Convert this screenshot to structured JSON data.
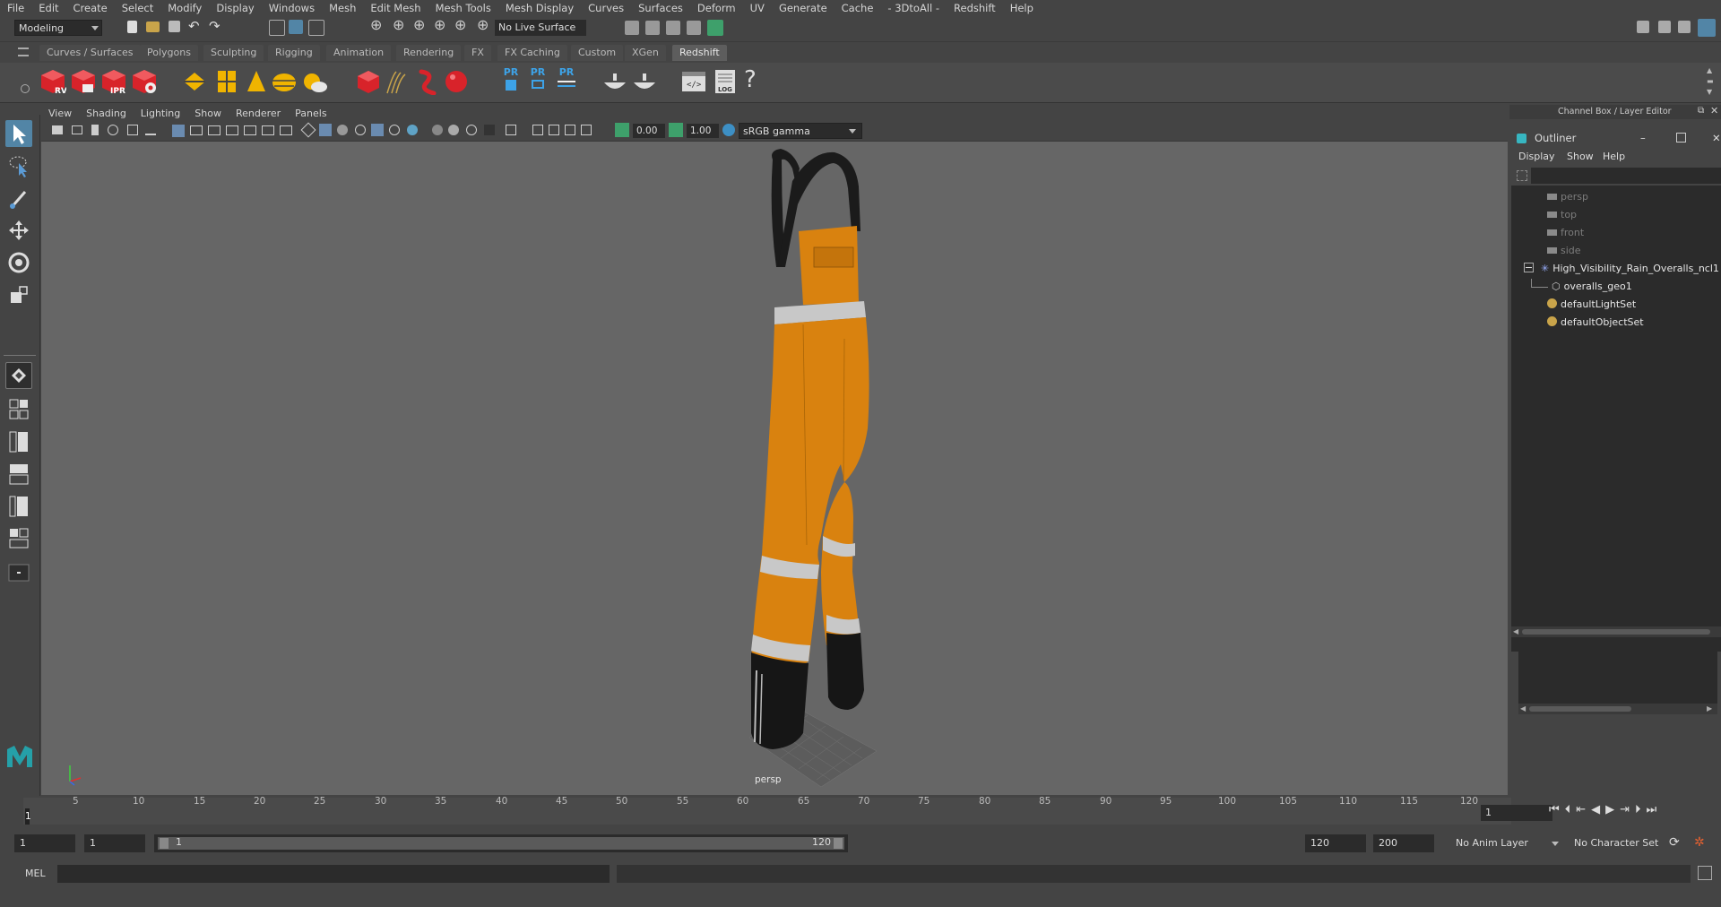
{
  "menubar": {
    "items": [
      "File",
      "Edit",
      "Create",
      "Select",
      "Modify",
      "Display",
      "Windows",
      "Mesh",
      "Edit Mesh",
      "Mesh Tools",
      "Mesh Display",
      "Curves",
      "Surfaces",
      "Deform",
      "UV",
      "Generate",
      "Cache",
      "- 3DtoAll -",
      "Redshift",
      "Help"
    ]
  },
  "statusline": {
    "mode": "Modeling",
    "live_surface": "No Live Surface"
  },
  "shelf": {
    "tabs": [
      "Curves / Surfaces",
      "Polygons",
      "Sculpting",
      "Rigging",
      "Animation",
      "Rendering",
      "FX",
      "FX Caching",
      "Custom",
      "XGen",
      "Redshift"
    ],
    "active_tab": "Redshift",
    "icon_labels": {
      "rv": "RV",
      "ipr": "IPR",
      "pr1": "PR",
      "pr2": "PR",
      "pr3": "PR",
      "log": "LOG",
      "help": "?"
    }
  },
  "viewport": {
    "menu": [
      "View",
      "Shading",
      "Lighting",
      "Show",
      "Renderer",
      "Panels"
    ],
    "exposure": "0.00",
    "gamma": "1.00",
    "color_space": "sRGB gamma",
    "camera_label": "persp"
  },
  "channel_box": {
    "title": "Channel Box / Layer Editor"
  },
  "outliner": {
    "title": "Outliner",
    "menu": [
      "Display",
      "Show",
      "Help"
    ],
    "items": [
      {
        "label": "persp",
        "icon": "camera-icon",
        "dim": true
      },
      {
        "label": "top",
        "icon": "camera-icon",
        "dim": true
      },
      {
        "label": "front",
        "icon": "camera-icon",
        "dim": true
      },
      {
        "label": "side",
        "icon": "camera-icon",
        "dim": true
      },
      {
        "label": "High_Visibility_Rain_Overalls_ncl1",
        "icon": "group-icon",
        "dim": false
      },
      {
        "label": "overalls_geo1",
        "icon": "mesh-icon",
        "dim": false
      },
      {
        "label": "defaultLightSet",
        "icon": "set-icon",
        "dim": false
      },
      {
        "label": "defaultObjectSet",
        "icon": "set-icon",
        "dim": false
      }
    ]
  },
  "timeline": {
    "ticks": [
      "5",
      "10",
      "15",
      "20",
      "25",
      "30",
      "35",
      "40",
      "45",
      "50",
      "55",
      "60",
      "65",
      "70",
      "75",
      "80",
      "85",
      "90",
      "95",
      "100",
      "105",
      "110",
      "115",
      "120"
    ],
    "start_label": "1",
    "current_frame": "1"
  },
  "range": {
    "start": "1",
    "playback_start": "1",
    "slider_start": "1",
    "slider_end": "120",
    "playback_end": "120",
    "end": "200",
    "anim_layer": "No Anim Layer",
    "character_set": "No Character Set"
  },
  "command_line": {
    "lang": "MEL"
  },
  "colors": {
    "overalls_orange": "#d9820f",
    "reflective_stripe": "#c8c8c8",
    "black_trim": "#161616",
    "accent_blue": "#5285a6",
    "redshift_red": "#d8232a"
  }
}
